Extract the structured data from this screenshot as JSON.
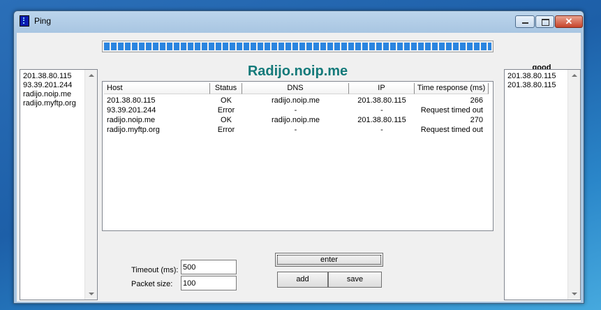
{
  "window": {
    "title": "Ping",
    "icon": "ping-app-icon",
    "controls": [
      "minimize-icon",
      "maximize-icon",
      "close-icon"
    ]
  },
  "progress": {
    "value": 1.0
  },
  "heading": "Radijo.noip.me",
  "good_label": "good",
  "hosts_list": [
    "201.38.80.115",
    "93.39.201.244",
    "radijo.noip.me",
    "radijo.myftp.org"
  ],
  "good_list": [
    "201.38.80.115",
    "201.38.80.115"
  ],
  "table": {
    "columns": [
      "Host",
      "Status",
      "DNS",
      "IP",
      "Time response (ms)"
    ],
    "rows": [
      {
        "host": "201.38.80.115",
        "status": "OK",
        "dns": "radijo.noip.me",
        "ip": "201.38.80.115",
        "time": "266"
      },
      {
        "host": "93.39.201.244",
        "status": "Error",
        "dns": "-",
        "ip": "-",
        "time": "Request timed out"
      },
      {
        "host": "radijo.noip.me",
        "status": "OK",
        "dns": "radijo.noip.me",
        "ip": "201.38.80.115",
        "time": "270"
      },
      {
        "host": "radijo.myftp.org",
        "status": "Error",
        "dns": "-",
        "ip": "-",
        "time": "Request timed out"
      }
    ]
  },
  "form": {
    "timeout_label": "Timeout (ms):",
    "timeout_value": "500",
    "packet_label": "Packet size:",
    "packet_value": "100"
  },
  "buttons": {
    "enter": "enter",
    "add": "add",
    "save": "save"
  },
  "colors": {
    "heading": "#147a7a",
    "progress": "#2b85e0"
  }
}
